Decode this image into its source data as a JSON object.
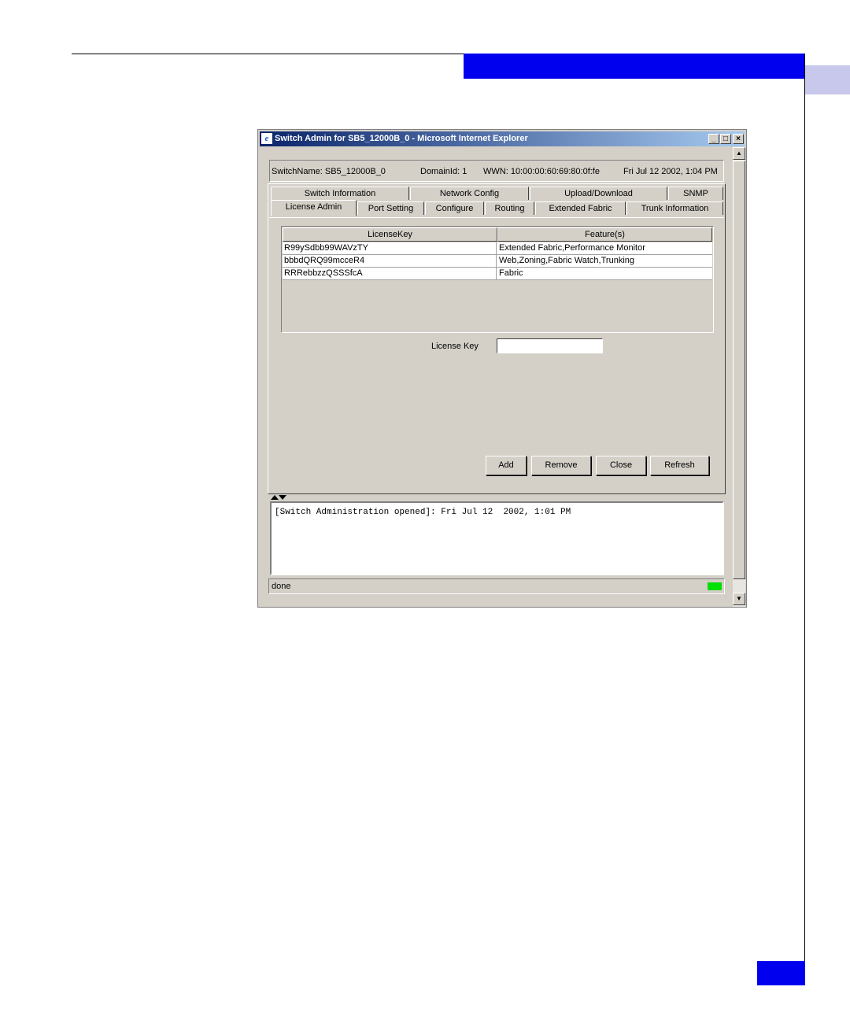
{
  "window": {
    "title": "Switch Admin for SB5_12000B_0 - Microsoft Internet Explorer",
    "controls": {
      "minimize": "_",
      "maximize": "□",
      "close": "×"
    }
  },
  "info": {
    "switch_name": "SwitchName: SB5_12000B_0",
    "domain_id": "DomainId: 1",
    "wwn": "WWN: 10:00:00:60:69:80:0f:fe",
    "datetime": "Fri Jul 12  2002, 1:04 PM"
  },
  "tabs": {
    "row_back": [
      "Switch Information",
      "Network Config",
      "Upload/Download",
      "SNMP"
    ],
    "row_front": [
      "License Admin",
      "Port Setting",
      "Configure",
      "Routing",
      "Extended Fabric",
      "Trunk Information"
    ],
    "active": "License Admin"
  },
  "license_table": {
    "headers": [
      "LicenseKey",
      "Feature(s)"
    ],
    "rows": [
      [
        "R99ySdbb99WAVzTY",
        "Extended Fabric,Performance Monitor"
      ],
      [
        "bbbdQRQ99mcceR4",
        "Web,Zoning,Fabric Watch,Trunking"
      ],
      [
        "RRRebbzzQSSSfcA",
        "Fabric"
      ]
    ]
  },
  "license_key": {
    "label": "License Key",
    "value": ""
  },
  "buttons": {
    "add": "Add",
    "remove": "Remove",
    "close": "Close",
    "refresh": "Refresh"
  },
  "log": {
    "text": "[Switch Administration opened]: Fri Jul 12  2002, 1:01 PM"
  },
  "status": {
    "text": "done",
    "indicator_color": "#00e000"
  },
  "page": {
    "accent_color": "#0000ee"
  }
}
